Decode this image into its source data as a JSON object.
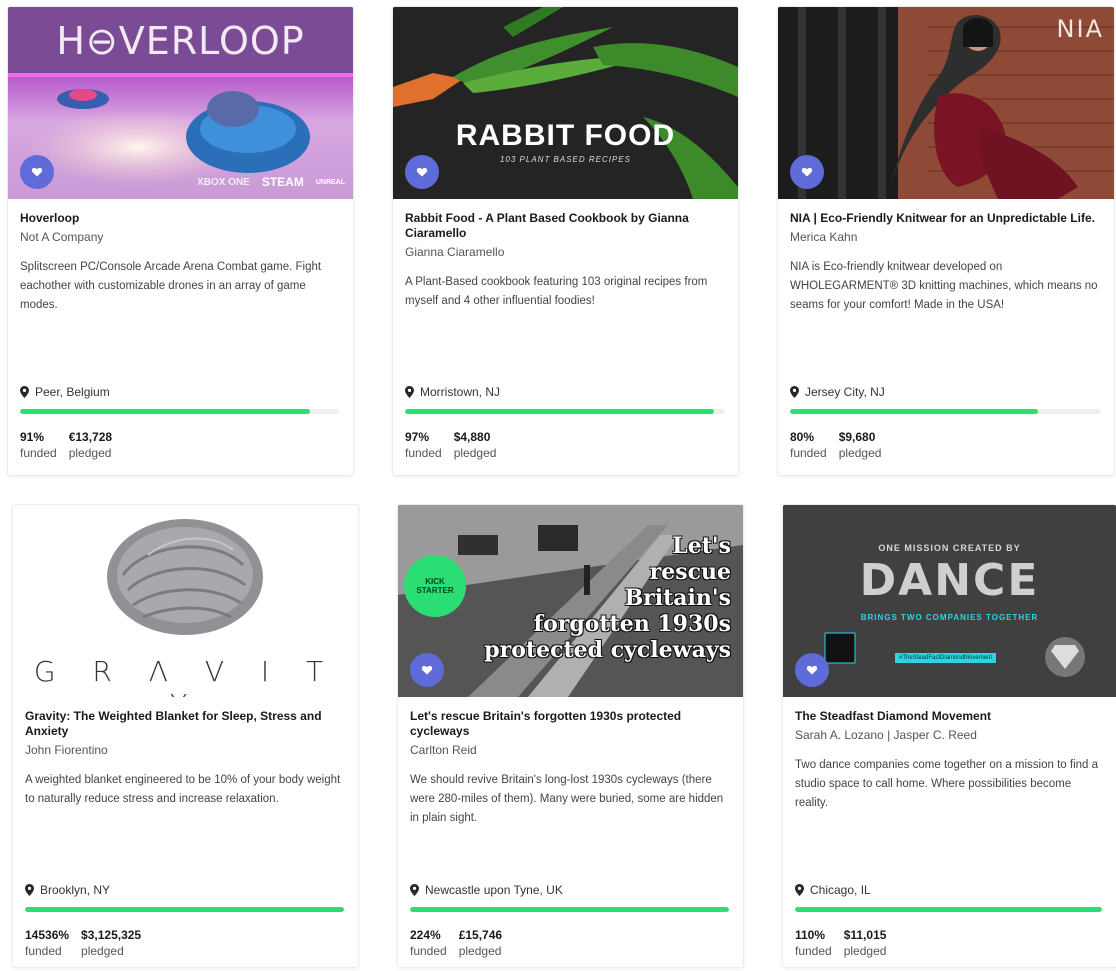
{
  "colors": {
    "accent": "#5f6bd8",
    "progress": "#2bde73",
    "progress_track": "#efefef"
  },
  "icons": {
    "like": "heart-icon",
    "location": "map-pin-icon"
  },
  "labels": {
    "funded": "funded",
    "pledged": "pledged"
  },
  "projects": [
    {
      "image_text": "H⊖VERLOOP",
      "image_badges": [
        "XBOX ONE",
        "STEAM",
        "UNREAL"
      ],
      "title": "Hoverloop",
      "creator": "Not A Company",
      "blurb": "Splitscreen PC/Console Arcade Arena Combat game. Fight eachother with customizable drones in an array of game modes.",
      "location": "Peer, Belgium",
      "progress": 0.91,
      "percent": "91%",
      "pledged": "€13,728"
    },
    {
      "image_text": "RABBIT FOOD",
      "image_subtext": "103 PLANT BASED RECIPES",
      "title": "Rabbit Food - A Plant Based Cookbook by Gianna Ciaramello",
      "creator": "Gianna Ciaramello",
      "blurb": "A Plant-Based cookbook featuring 103 original recipes from myself and 4 other influential foodies!",
      "location": "Morristown, NJ",
      "progress": 0.97,
      "percent": "97%",
      "pledged": "$4,880"
    },
    {
      "image_text": "NIA",
      "title": "NIA | Eco-Friendly Knitwear for an Unpredictable Life.",
      "creator": "Merica Kahn",
      "blurb": "NIA is Eco-friendly knitwear developed on WHOLEGARMENT® 3D knitting machines, which means no seams for your comfort! Made in the USA!",
      "location": "Jersey City, NJ",
      "progress": 0.8,
      "percent": "80%",
      "pledged": "$9,680"
    },
    {
      "image_text": "G R Λ V I T Y",
      "title": "Gravity: The Weighted Blanket for Sleep, Stress and Anxiety",
      "creator": "John Fiorentino",
      "blurb": "A weighted blanket engineered to be 10% of your body weight to naturally reduce stress and increase relaxation.",
      "location": "Brooklyn, NY",
      "progress": 1.0,
      "percent": "14536%",
      "pledged": "$3,125,325"
    },
    {
      "image_text_lines": [
        "Let's",
        "rescue",
        "Britain's",
        "forgotten 1930s",
        "protected cycleways"
      ],
      "image_badge": "KICK STARTER",
      "title": "Let's rescue Britain's forgotten 1930s protected cycleways",
      "creator": "Carlton Reid",
      "blurb": "We should revive Britain's long-lost 1930s cycleways (there were 280-miles of them). Many were buried, some are hidden in plain sight.",
      "location": "Newcastle upon Tyne, UK",
      "progress": 1.0,
      "percent": "224%",
      "pledged": "£15,746"
    },
    {
      "image_text": "DANCE",
      "image_subtext_top": "ONE MISSION CREATED BY",
      "image_subtext": "BRINGS TWO COMPANIES TOGETHER",
      "image_tag": "#TheSteadFastDiamondMovement",
      "title": "The Steadfast Diamond Movement",
      "creator": "Sarah A. Lozano | Jasper C. Reed",
      "blurb": "Two dance companies come together on a mission to find a studio space to call home. Where possibilities become reality.",
      "location": "Chicago, IL",
      "progress": 1.0,
      "percent": "110%",
      "pledged": "$11,015"
    }
  ]
}
